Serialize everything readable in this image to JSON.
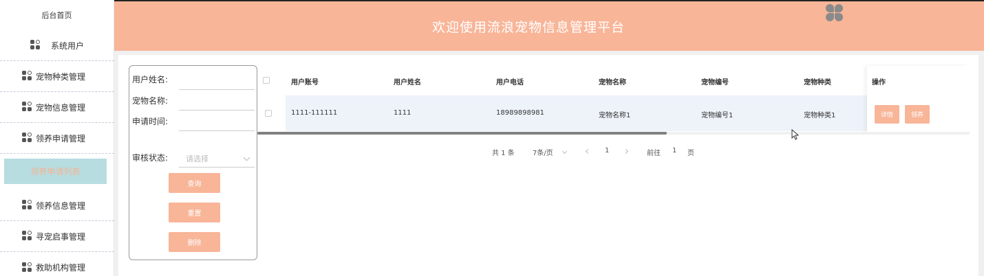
{
  "sidebar": {
    "home": "后台首页",
    "items": [
      {
        "label": "系统用户"
      },
      {
        "label": "宠物种类管理"
      },
      {
        "label": "宠物信息管理"
      },
      {
        "label": "领养申请管理"
      },
      {
        "label": "领养申请列表"
      },
      {
        "label": "领养信息管理"
      },
      {
        "label": "寻宠启事管理"
      },
      {
        "label": "救助机构管理"
      }
    ]
  },
  "header": {
    "title": "欢迎使用流浪宠物信息管理平台"
  },
  "search": {
    "username_label": "用户姓名:",
    "petname_label": "宠物名称:",
    "time_label": "申请时间:",
    "status_label": "审核状态:",
    "status_placeholder": "请选择",
    "query_button": "查询",
    "reset_button": "重置",
    "delete_button": "删除"
  },
  "table": {
    "columns": [
      "用户账号",
      "用户姓名",
      "用户电话",
      "宠物名称",
      "宠物编号",
      "宠物种类",
      "操作"
    ],
    "rows": [
      {
        "account": "1111-111111",
        "name": "1111",
        "phone": "18989898981",
        "pet_name": "宠物名称1",
        "pet_no": "宠物编号1",
        "pet_type": "宠物种类1"
      }
    ],
    "detail_button": "详情",
    "adopt_button": "领养"
  },
  "pager": {
    "total": "共 1 条",
    "page_size": "7条/页",
    "current": "1",
    "goto_label": "前往",
    "goto_value": "1",
    "page_suffix": "页"
  },
  "colors": {
    "accent": "#f8b598",
    "active_bg": "#b7dde0",
    "row_bg": "#eef3fa"
  }
}
